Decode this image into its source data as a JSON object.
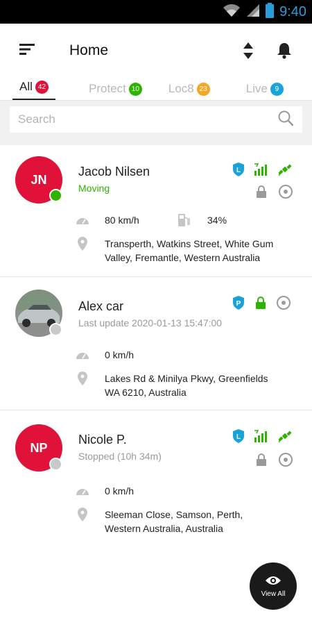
{
  "status_bar": {
    "time": "9:40",
    "icons": [
      "wifi-icon",
      "signal-icon",
      "battery-icon"
    ]
  },
  "header": {
    "title": "Home",
    "menu_icon": "menu-icon",
    "sort_icon": "sort-icon",
    "bell_icon": "bell-icon"
  },
  "tabs": [
    {
      "label": "All",
      "count": "42",
      "color": "#e0123a"
    },
    {
      "label": "Protect",
      "count": "10",
      "color": "#2db400"
    },
    {
      "label": "Loc8",
      "count": "23",
      "color": "#f5a623"
    },
    {
      "label": "Live",
      "count": "9",
      "color": "#1aa3d9"
    }
  ],
  "search": {
    "placeholder": "Search"
  },
  "devices": [
    {
      "initials": "JN",
      "name": "Jacob Nilsen",
      "status": "Moving",
      "speed": "80 km/h",
      "fuel": "34%",
      "address": [
        "Transperth, Watkins Street, White Gum",
        "Valley, Fremantle, Western Australia"
      ],
      "badge": "L"
    },
    {
      "initials": "",
      "name": "Alex car",
      "status": "Last update 2020-01-13 15:47:00",
      "speed": "0 km/h",
      "address": [
        "Lakes Rd & Minilya Pkwy, Greenfields",
        "WA 6210, Australia"
      ],
      "badge": "P"
    },
    {
      "initials": "NP",
      "name": "Nicole P.",
      "status": "Stopped (10h 34m)",
      "speed": "0 km/h",
      "address": [
        "Sleeman Close, Samson, Perth,",
        "Western Australia, Australia"
      ],
      "badge": "L"
    }
  ],
  "fab": {
    "label": "View All",
    "icon": "eye-icon"
  },
  "colors": {
    "accent_red": "#e0123a",
    "green": "#2db400",
    "blue": "#1aa3d9",
    "gray_icon": "#b0b0b0"
  }
}
